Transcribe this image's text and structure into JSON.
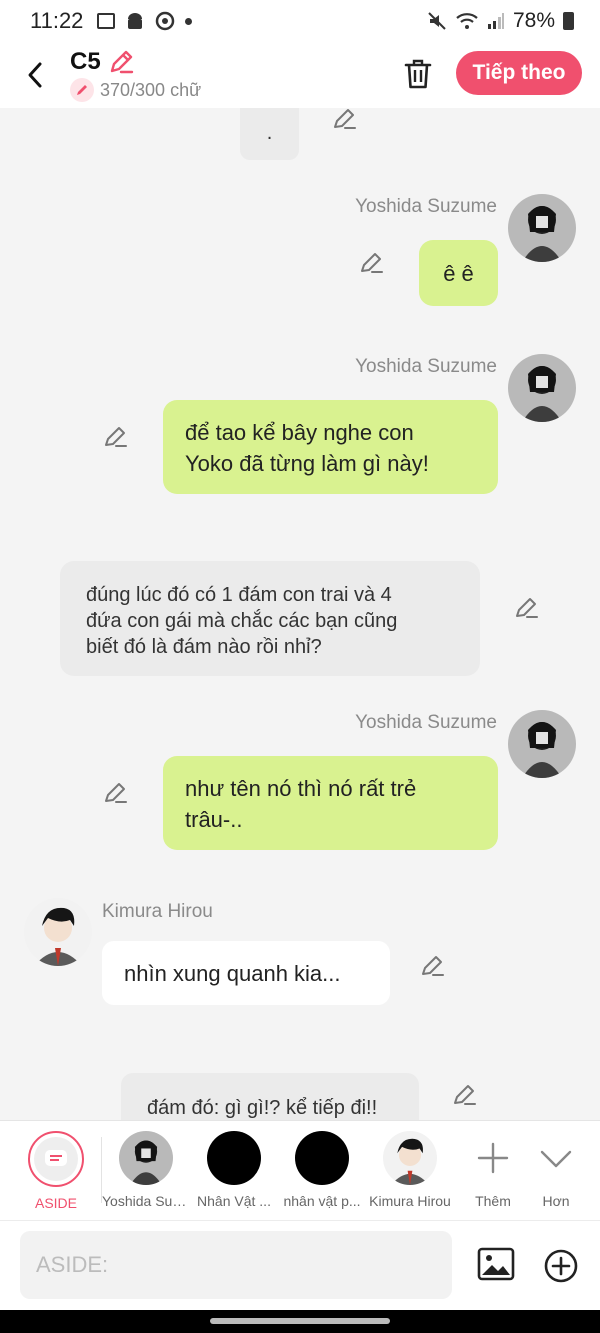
{
  "status_bar": {
    "time": "11:22",
    "battery": "78%"
  },
  "header": {
    "title": "C5",
    "word_count": "370/300 chữ",
    "next_label": "Tiếp theo"
  },
  "messages": {
    "m0": {
      "text": "."
    },
    "m1": {
      "sender": "Yoshida Suzume",
      "text": "ê ê"
    },
    "m2": {
      "sender": "Yoshida Suzume",
      "line1": "để tao kể bây nghe con",
      "line2": "Yoko đã từng làm gì này!"
    },
    "m3": {
      "line1": "đúng lúc đó có 1 đám con trai và 4",
      "line2": "đứa con gái mà chắc các bạn cũng",
      "line3": "biết đó là đám nào rồi nhỉ?"
    },
    "m4": {
      "sender": "Yoshida Suzume",
      "line1": "như tên nó thì nó rất trẻ",
      "line2": "trâu-.."
    },
    "m5": {
      "sender": "Kimura Hirou",
      "text": "nhìn xung quanh kia..."
    },
    "m6": {
      "text": "đám đó: gì gì!? kể tiếp đi!!"
    }
  },
  "characters": {
    "aside": "ASIDE",
    "c1": "Yoshida Suzume",
    "c2": "Nhân Vật ...",
    "c3": "nhân vật p...",
    "c4": "Kimura Hirou",
    "more": "Thêm",
    "collapse": "Hơn"
  },
  "input": {
    "placeholder": "ASIDE:"
  },
  "colors": {
    "accent": "#f0506e",
    "green_bubble": "#d9f290",
    "gray_bubble": "#ebebeb"
  },
  "icons": [
    "back-arrow-icon",
    "pencil-icon",
    "trash-icon",
    "image-icon",
    "plus-circle-icon",
    "plus-icon",
    "chevron-down-icon"
  ]
}
